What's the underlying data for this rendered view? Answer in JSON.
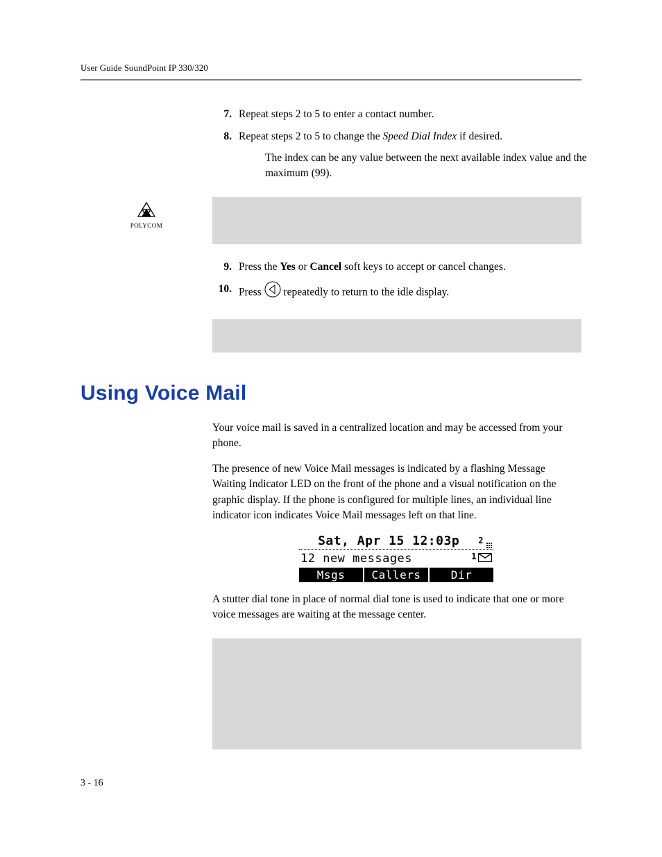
{
  "header": {
    "title": "User Guide SoundPoint IP 330/320"
  },
  "steps": {
    "s7": {
      "n": "7.",
      "t": "Repeat steps 2 to 5 to enter a contact number."
    },
    "s8": {
      "n": "8.",
      "t1": "Repeat steps 2 to 5 to change the ",
      "em": "Speed Dial Index",
      "t2": " if desired.",
      "sub": "The index can be any value between the next available index value and the maximum (99)."
    },
    "s9": {
      "n": "9.",
      "t1": "Press the ",
      "b1": "Yes",
      "t2": " or ",
      "b2": "Cancel",
      "t3": " soft keys to accept or cancel changes."
    },
    "s10": {
      "n": "10.",
      "t1": "Press ",
      "t2": " repeatedly to return to the idle display."
    }
  },
  "logo": {
    "brand": "POLYCOM"
  },
  "section": {
    "title": "Using Voice Mail"
  },
  "paras": {
    "p1": "Your voice mail is saved in a centralized location and may be accessed from your phone.",
    "p2": "The presence of new Voice Mail messages is indicated by a flashing Message Waiting Indicator LED on the front of the phone and a visual notification on the graphic display. If the phone is configured for multiple lines, an individual line indicator icon indicates Voice Mail messages left on that line.",
    "p3": "A stutter dial tone in place of normal dial tone is used to indicate that one or more voice messages are waiting at the message center."
  },
  "lcd": {
    "datetime": "Sat, Apr 15 12:03p",
    "super": "2",
    "msg": "12 new messages",
    "indicator": "1",
    "softkeys": {
      "a": "Msgs",
      "b": "Callers",
      "c": "Dir"
    }
  },
  "footer": {
    "pagenum": "3 - 16"
  }
}
